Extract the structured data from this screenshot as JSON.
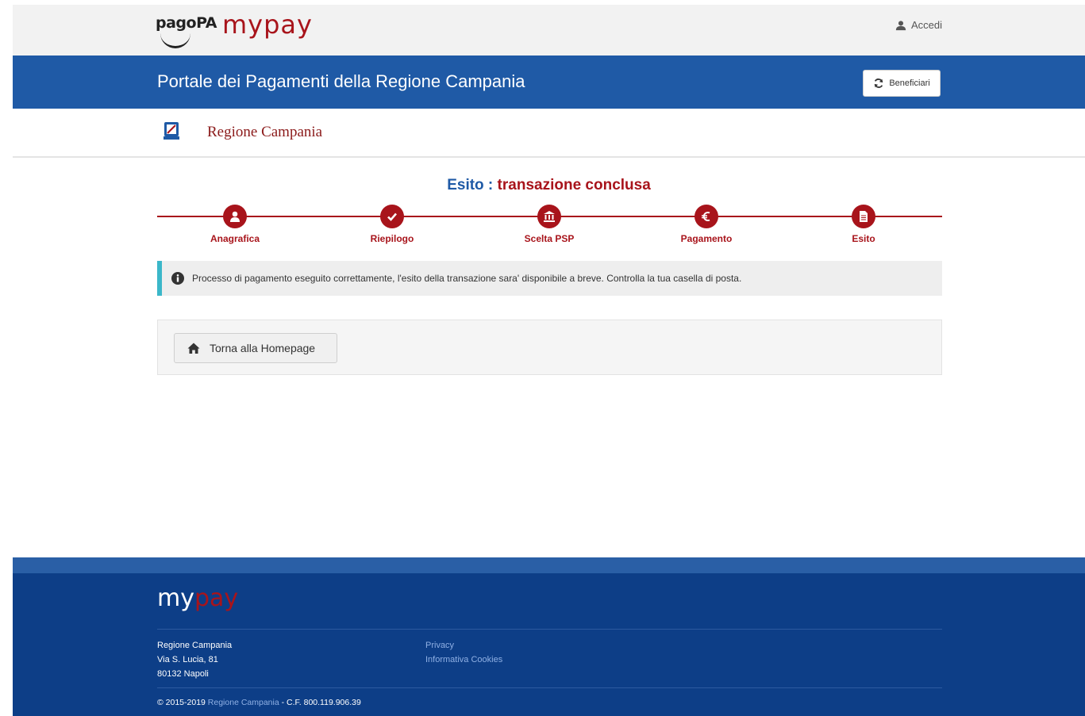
{
  "topbar": {
    "logo_pagopa": "pagoPA",
    "logo_mypay_my": "my",
    "logo_mypay_pay": "pay",
    "login_label": "Accedi"
  },
  "header": {
    "title": "Portale dei Pagamenti della Regione Campania",
    "beneficiary_button": "Beneficiari"
  },
  "region": {
    "name": "Regione Campania"
  },
  "status": {
    "label": "Esito : ",
    "value": "transazione conclusa"
  },
  "steps": [
    {
      "label": "Anagrafica",
      "icon": "user-icon"
    },
    {
      "label": "Riepilogo",
      "icon": "check-icon"
    },
    {
      "label": "Scelta PSP",
      "icon": "bank-icon"
    },
    {
      "label": "Pagamento",
      "icon": "euro-icon"
    },
    {
      "label": "Esito",
      "icon": "document-icon"
    }
  ],
  "alert": {
    "message": "Processo di pagamento eseguito correttamente, l'esito della transazione sara' disponibile a breve. Controlla la tua casella di posta."
  },
  "actions": {
    "home_button": "Torna alla Homepage"
  },
  "footer": {
    "logo_my": "my",
    "logo_pay": "pay",
    "address_line1": "Regione Campania",
    "address_line2": "Via S. Lucia, 81",
    "address_line3": "80132 Napoli",
    "link_privacy": "Privacy",
    "link_cookies": "Informativa Cookies",
    "copyright_prefix": "© 2015-2019 ",
    "copyright_link": "Regione Campania",
    "copyright_suffix": " - C.F. 800.119.906.39"
  },
  "colors": {
    "brand_red": "#a8141b",
    "header_blue": "#1f5aa6",
    "footer_blue": "#0d3e87",
    "info_accent": "#3bb7c9"
  }
}
